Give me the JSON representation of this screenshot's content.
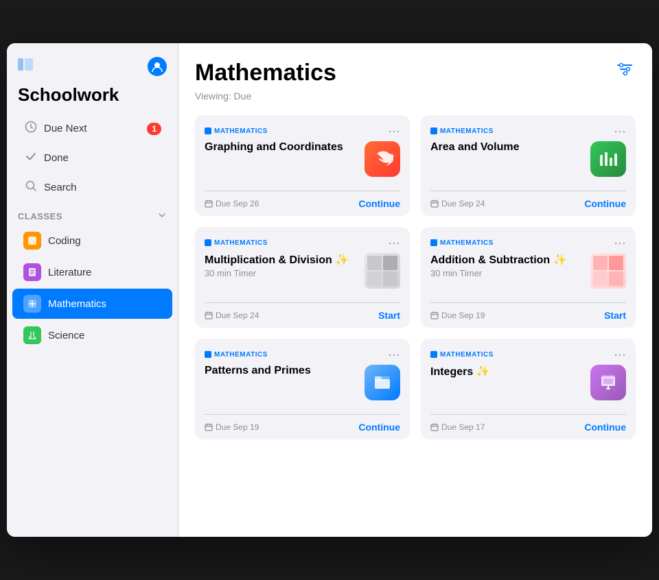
{
  "sidebar": {
    "icon": "⊞",
    "app_title": "Schoolwork",
    "nav_items": [
      {
        "id": "due-next",
        "icon": "🕐",
        "label": "Due Next",
        "badge": "1"
      },
      {
        "id": "done",
        "icon": "✓",
        "label": "Done",
        "badge": null
      },
      {
        "id": "search",
        "icon": "🔍",
        "label": "Search",
        "badge": null
      }
    ],
    "classes_section": {
      "label": "Classes",
      "items": [
        {
          "id": "coding",
          "label": "Coding",
          "color": "orange"
        },
        {
          "id": "literature",
          "label": "Literature",
          "color": "purple"
        },
        {
          "id": "mathematics",
          "label": "Mathematics",
          "color": "blue",
          "active": true
        },
        {
          "id": "science",
          "label": "Science",
          "color": "green"
        }
      ]
    }
  },
  "main": {
    "title": "Mathematics",
    "viewing_label": "Viewing: Due",
    "filter_icon": "≡",
    "assignments": [
      {
        "id": "graphing",
        "class_label": "Mathematics",
        "title": "Graphing and Coordinates",
        "subtitle": "",
        "app_icon_type": "swift",
        "app_icon_glyph": "🐦",
        "due": "Due Sep 26",
        "action": "Continue"
      },
      {
        "id": "area-volume",
        "class_label": "Mathematics",
        "title": "Area and Volume",
        "subtitle": "",
        "app_icon_type": "numbers",
        "app_icon_glyph": "📊",
        "due": "Due Sep 24",
        "action": "Continue"
      },
      {
        "id": "multiplication",
        "class_label": "Mathematics",
        "title": "Multiplication & Division ✨",
        "subtitle": "30 min Timer",
        "app_icon_type": "thumbnail",
        "due": "Due Sep 24",
        "action": "Start"
      },
      {
        "id": "addition",
        "class_label": "Mathematics",
        "title": "Addition & Subtraction ✨",
        "subtitle": "30 min Timer",
        "app_icon_type": "thumbnail2",
        "due": "Due Sep 19",
        "action": "Start"
      },
      {
        "id": "patterns",
        "class_label": "Mathematics",
        "title": "Patterns and Primes",
        "subtitle": "",
        "app_icon_type": "files",
        "app_icon_glyph": "🗂️",
        "due": "Due Sep 19",
        "action": "Continue"
      },
      {
        "id": "integers",
        "class_label": "Mathematics",
        "title": "Integers ✨",
        "subtitle": "",
        "app_icon_type": "keynote",
        "app_icon_glyph": "🎯",
        "due": "Due Sep 17",
        "action": "Continue"
      }
    ]
  }
}
